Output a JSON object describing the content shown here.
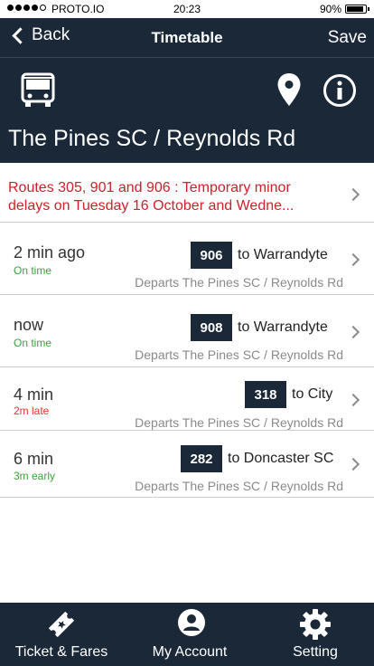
{
  "status_bar": {
    "carrier": "PROTO.IO",
    "time": "20:23",
    "battery": "90%",
    "battery_level": 0.9
  },
  "nav": {
    "back_label": "Back",
    "title": "Timetable",
    "save_label": "Save"
  },
  "header": {
    "stop_name": "The Pines SC / Reynolds Rd",
    "icons": [
      "bus-icon",
      "map-pin-icon",
      "info-icon"
    ]
  },
  "alert": {
    "line1": "Routes 305, 901 and 906 : Temporary minor",
    "line2": "delays on Tuesday 16 October and Wedne...",
    "color": "#d0202a"
  },
  "departures": [
    {
      "when": "2 min ago",
      "status": "On time",
      "route": "906",
      "destination": "to Warrandyte",
      "departs": "Departs The Pines SC / Reynolds Rd"
    },
    {
      "when": "now",
      "status": "On time",
      "route": "908",
      "destination": "to Warrandyte",
      "departs": "Departs The Pines SC / Reynolds Rd"
    },
    {
      "when": "4 min",
      "status": "2m late",
      "route": "318",
      "destination": "to City",
      "departs": "Departs The Pines SC / Reynolds Rd"
    },
    {
      "when": "6 min",
      "status": "3m early",
      "route": "282",
      "destination": "to Doncaster SC",
      "departs": "Departs The Pines SC / Reynolds Rd"
    }
  ],
  "tabs": [
    {
      "label": "Ticket & Fares",
      "icon": "ticket-icon"
    },
    {
      "label": "My Account",
      "icon": "account-icon"
    },
    {
      "label": "Setting",
      "icon": "gear-icon"
    }
  ],
  "colors": {
    "header_bg": "#1b2838",
    "on_time": "#3aa53a",
    "late": "#e03a30",
    "alert": "#d0202a"
  }
}
